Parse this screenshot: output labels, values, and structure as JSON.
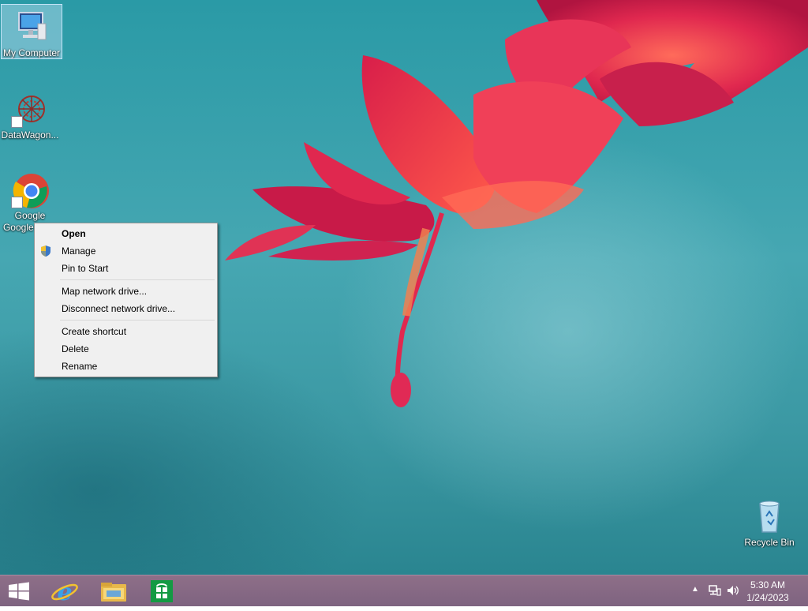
{
  "desktop": {
    "icons": [
      {
        "label": "My Computer",
        "icon": "computer-icon",
        "selected": true
      },
      {
        "label": "DataWagon...",
        "icon": "datawagon-icon"
      },
      {
        "label": "Google Chro",
        "icon": "chrome-icon"
      },
      {
        "label": "Recycle Bin",
        "icon": "recycle-bin-icon"
      }
    ]
  },
  "context_menu": {
    "items": [
      {
        "label": "Open",
        "default": true
      },
      {
        "label": "Manage",
        "icon": "uac-shield-icon"
      },
      {
        "label": "Pin to Start"
      },
      {
        "label": "Map network drive..."
      },
      {
        "label": "Disconnect network drive..."
      },
      {
        "label": "Create shortcut"
      },
      {
        "label": "Delete"
      },
      {
        "label": "Rename"
      }
    ]
  },
  "taskbar": {
    "pinned": [
      {
        "icon": "windows-start-icon"
      },
      {
        "icon": "internet-explorer-icon"
      },
      {
        "icon": "file-explorer-icon"
      },
      {
        "icon": "store-icon"
      }
    ],
    "tray": {
      "icons": [
        "show-hidden-icons-chevron",
        "network-icon",
        "volume-icon"
      ],
      "time": "5:30 AM",
      "date": "1/24/2023"
    }
  },
  "colors": {
    "desktop_teal": "#3fa3ae",
    "taskbar": "#856985",
    "menu_bg": "#f0f0f0",
    "flower": "#e0284f"
  }
}
